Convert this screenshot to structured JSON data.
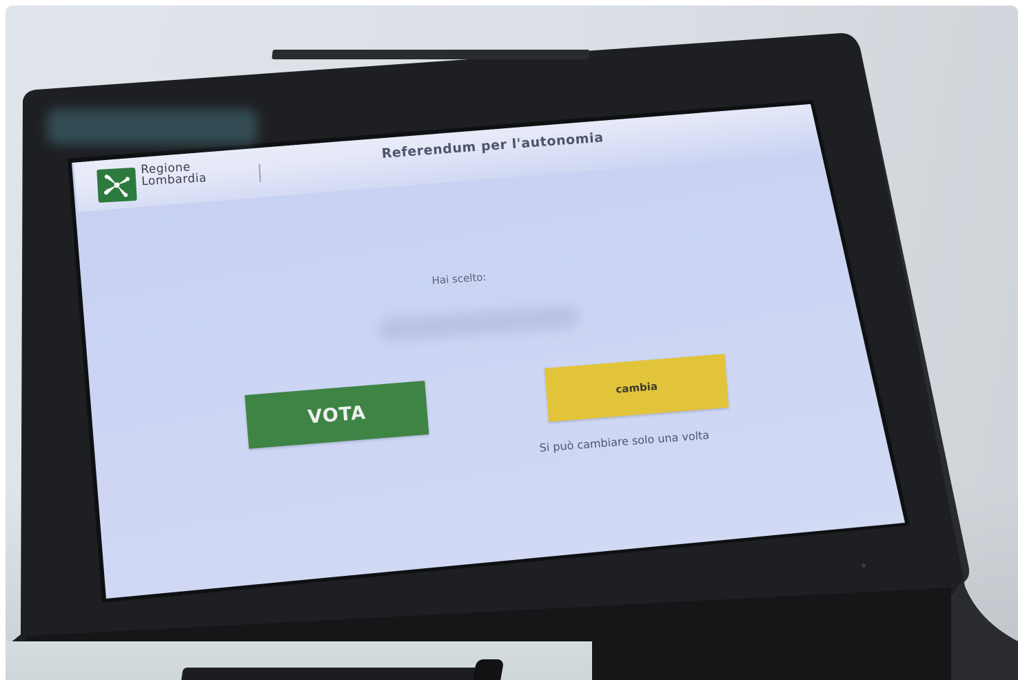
{
  "screen": {
    "header": {
      "logo_line1": "Regione",
      "logo_line2": "Lombardia",
      "title": "Referendum per l'autonomia"
    },
    "prompt": "Hai scelto:",
    "buttons": {
      "vote_label": "VOTA",
      "change_label": "cambia"
    },
    "note": "Si può cambiare solo una volta"
  },
  "colors": {
    "vote_button": "#3d8445",
    "change_button": "#e2c43a",
    "logo_green": "#2d7a3e",
    "device_body": "#1e1f22",
    "screen_background": "#c9d2f1"
  },
  "icons": {
    "logo": "regione-lombardia-logo-icon"
  }
}
